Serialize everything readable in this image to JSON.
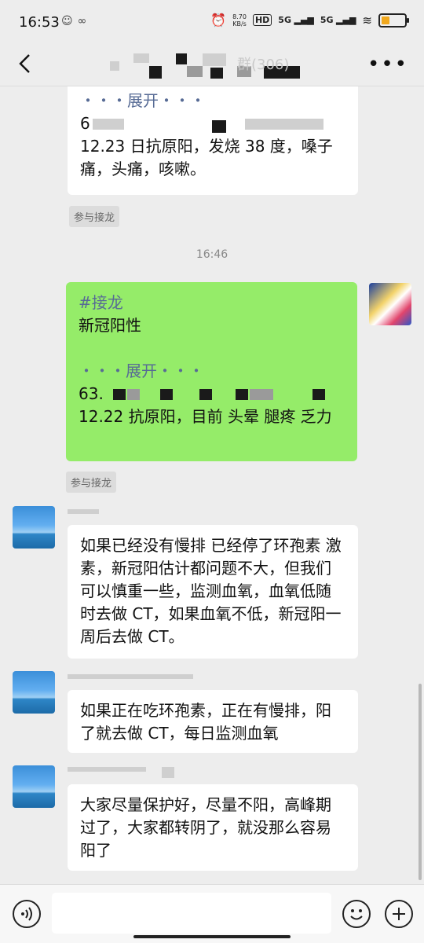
{
  "status_bar": {
    "time": "16:53",
    "net_speed_value": "8.70",
    "net_speed_unit": "KB/s",
    "hd": "HD",
    "sig1": "5G",
    "sig2": "5G"
  },
  "header": {
    "chat_title_suffix": "群(306)"
  },
  "messages": {
    "m1": {
      "expand": "・・・展开・・・",
      "line_partial": "6",
      "line2": "12.23 日抗原阳，发烧 38 度，嗓子痛，头痛，咳嗽。",
      "join": "参与接龙"
    },
    "ts": "16:46",
    "m2": {
      "tag": "#接龙",
      "line1": "新冠阳性",
      "expand": "・・・展开・・・",
      "line_partial": "63.",
      "line2": "12.22 抗原阳，目前 头晕 腿疼 乏力",
      "join": "参与接龙"
    },
    "m3": {
      "text": "如果已经没有慢排 已经停了环孢素 激素，新冠阳估计都问题不大，但我们可以慎重一些，监测血氧，血氧低随时去做 CT，如果血氧不低，新冠阳一周后去做 CT。"
    },
    "m4": {
      "text": "如果正在吃环孢素，正在有慢排，阳了就去做 CT，每日监测血氧"
    },
    "m5": {
      "text": "大家尽量保护好，尽量不阳，高峰期过了，大家都转阴了，就没那么容易阳了"
    }
  },
  "input": {
    "placeholder": ""
  }
}
